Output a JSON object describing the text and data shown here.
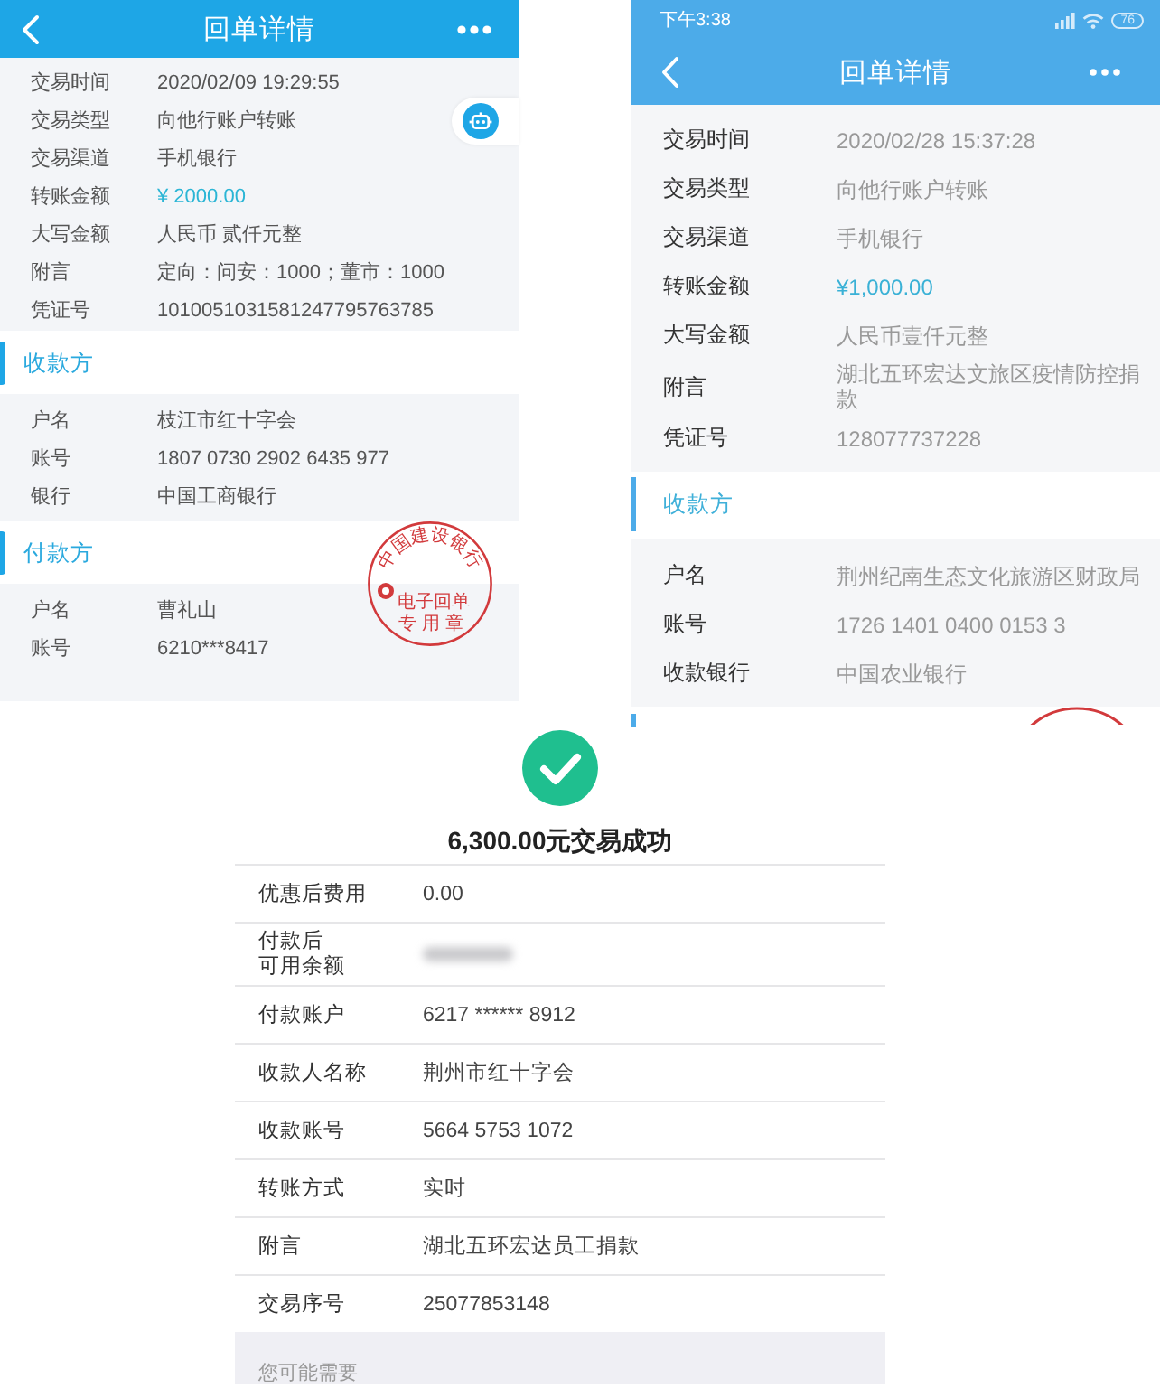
{
  "receipt_1": {
    "title": "回单详情",
    "details": [
      {
        "label": "交易时间",
        "value": "2020/02/09 19:29:55",
        "kind": "plain"
      },
      {
        "label": "交易类型",
        "value": "向他行账户转账",
        "kind": "plain"
      },
      {
        "label": "交易渠道",
        "value": "手机银行",
        "kind": "plain"
      },
      {
        "label": "转账金额",
        "value": "¥ 2000.00",
        "kind": "amount"
      },
      {
        "label": "大写金额",
        "value": "人民币 贰仟元整",
        "kind": "plain"
      },
      {
        "label": "附言",
        "value": "定向：问安：1000；董市：1000",
        "kind": "plain"
      },
      {
        "label": "凭证号",
        "value": "1010051031581247795763785",
        "kind": "plain"
      }
    ],
    "sections": [
      {
        "heading": "收款方",
        "rows": [
          {
            "label": "户名",
            "value": "枝江市红十字会"
          },
          {
            "label": "账号",
            "value": "1807 0730 2902 6435 977"
          },
          {
            "label": "银行",
            "value": "中国工商银行"
          }
        ]
      },
      {
        "heading": "付款方",
        "rows": [
          {
            "label": "户名",
            "value": "曹礼山"
          },
          {
            "label": "账号",
            "value": "6210***8417"
          }
        ]
      }
    ],
    "stamp": {
      "arc_text": "中国建设银行",
      "line_1": "电子回单",
      "line_2": "专用章"
    }
  },
  "receipt_2": {
    "status_bar": {
      "time": "下午3:38",
      "battery": "76"
    },
    "title": "回单详情",
    "details": [
      {
        "label": "交易时间",
        "value": "2020/02/28 15:37:28",
        "kind": "plain"
      },
      {
        "label": "交易类型",
        "value": "向他行账户转账",
        "kind": "plain"
      },
      {
        "label": "交易渠道",
        "value": "手机银行",
        "kind": "plain"
      },
      {
        "label": "转账金额",
        "value": "¥1,000.00",
        "kind": "amount"
      },
      {
        "label": "大写金额",
        "value": "人民币壹仟元整",
        "kind": "plain"
      },
      {
        "label": "附言",
        "value": "湖北五环宏达文旅区疫情防控捐款",
        "kind": "plain"
      },
      {
        "label": "凭证号",
        "value": "128077737228",
        "kind": "plain"
      }
    ],
    "sections": [
      {
        "heading": "收款方",
        "rows": [
          {
            "label": "户名",
            "value": "荆州纪南生态文化旅游区财政局"
          },
          {
            "label": "账号",
            "value": "1726 1401 0400 0153 3"
          },
          {
            "label": "收款银行",
            "value": "中国农业银行"
          }
        ]
      }
    ]
  },
  "transfer_result": {
    "title": "6,300.00元交易成功",
    "rows": [
      {
        "label": "优惠后费用",
        "value": "0.00",
        "kind": "plain"
      },
      {
        "label": "付款后",
        "label_2": "可用余额",
        "kind": "blurred"
      },
      {
        "label": "付款账户",
        "value": "6217 ****** 8912",
        "kind": "plain"
      },
      {
        "label": "收款人名称",
        "value": "荆州市红十字会",
        "kind": "plain"
      },
      {
        "label": "收款账号",
        "value": "5664 5753 1072",
        "kind": "plain"
      },
      {
        "label": "转账方式",
        "value": "实时",
        "kind": "plain"
      },
      {
        "label": "附言",
        "value": "湖北五环宏达员工捐款",
        "kind": "plain"
      },
      {
        "label": "交易序号",
        "value": "25077853148",
        "kind": "plain"
      }
    ],
    "footer": "您可能需要"
  }
}
